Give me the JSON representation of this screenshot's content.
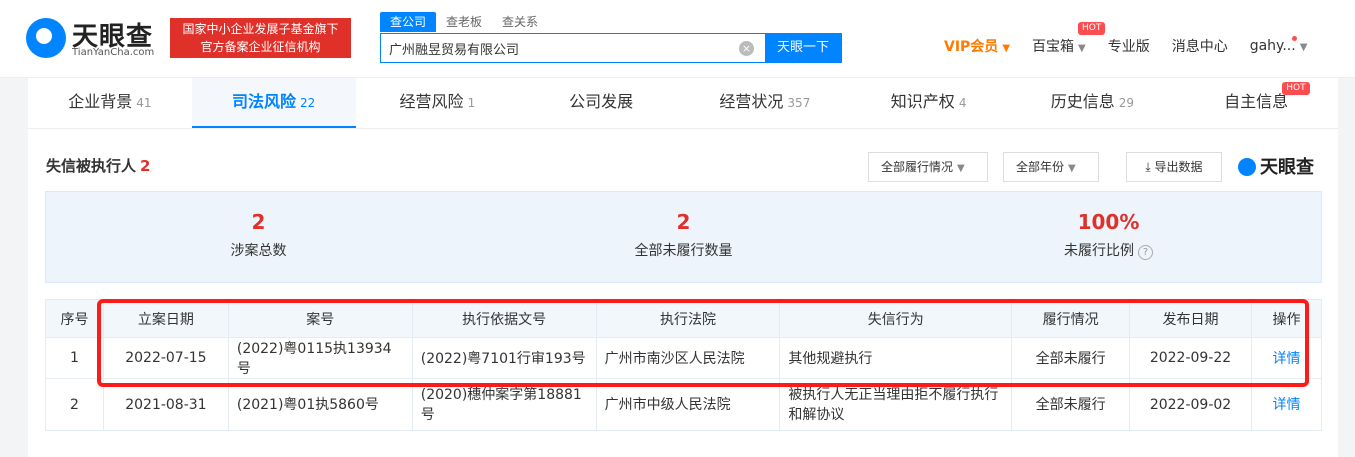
{
  "header": {
    "logo_text": "天眼查",
    "logo_sub": "TianYanCha.com",
    "banner_line1": "国家中小企业发展子基金旗下",
    "banner_line2": "官方备案企业征信机构",
    "search_tabs": [
      "查公司",
      "查老板",
      "查关系"
    ],
    "search_value": "广州融昱贸易有限公司",
    "search_button": "天眼一下",
    "nav": {
      "vip": "VIP会员",
      "baobox": "百宝箱",
      "hot": "HOT",
      "pro": "专业版",
      "messages": "消息中心",
      "user": "gahy..."
    }
  },
  "tabs": [
    {
      "label": "企业背景",
      "count": "41"
    },
    {
      "label": "司法风险",
      "count": "22"
    },
    {
      "label": "经营风险",
      "count": "1"
    },
    {
      "label": "公司发展",
      "count": ""
    },
    {
      "label": "经营状况",
      "count": "357"
    },
    {
      "label": "知识产权",
      "count": "4"
    },
    {
      "label": "历史信息",
      "count": "29"
    },
    {
      "label": "自主信息",
      "count": "",
      "badge": "HOT"
    }
  ],
  "section": {
    "title": "失信被执行人",
    "count": "2",
    "filter_status": "全部履行情况",
    "filter_year": "全部年份",
    "export": "导出数据",
    "brand": "天眼查"
  },
  "stats": [
    {
      "value": "2",
      "label": "涉案总数"
    },
    {
      "value": "2",
      "label": "全部未履行数量"
    },
    {
      "value": "100%",
      "label": "未履行比例"
    }
  ],
  "table": {
    "headers": [
      "序号",
      "立案日期",
      "案号",
      "执行依据文号",
      "执行法院",
      "失信行为",
      "履行情况",
      "发布日期",
      "操作"
    ],
    "rows": [
      [
        "1",
        "2022-07-15",
        "(2022)粤0115执13934号",
        "(2022)粤7101行审193号",
        "广州市南沙区人民法院",
        "其他规避执行",
        "全部未履行",
        "2022-09-22",
        "详情"
      ],
      [
        "2",
        "2021-08-31",
        "(2021)粤01执5860号",
        "(2020)穗仲案字第18881号",
        "广州市中级人民法院",
        "被执行人无正当理由拒不履行执行和解协议",
        "全部未履行",
        "2022-09-02",
        "详情"
      ]
    ]
  }
}
